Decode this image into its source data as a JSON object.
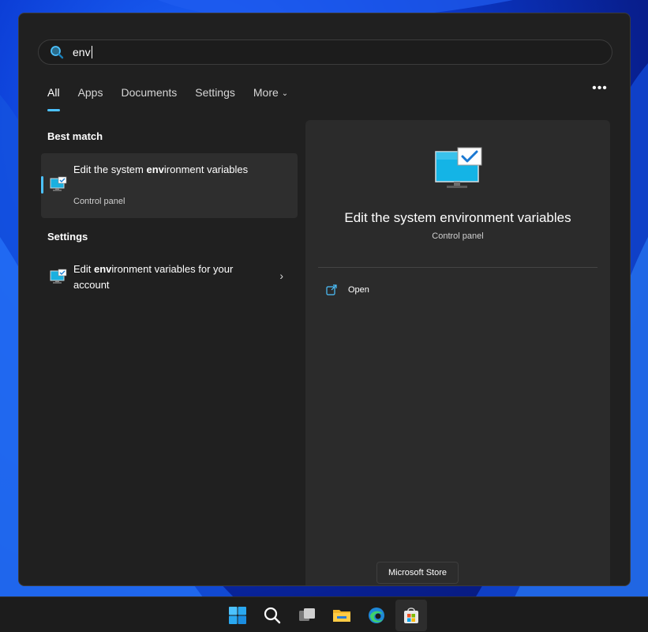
{
  "search": {
    "query": "env",
    "placeholder": ""
  },
  "tabs": [
    {
      "label": "All",
      "active": true
    },
    {
      "label": "Apps",
      "active": false
    },
    {
      "label": "Documents",
      "active": false
    },
    {
      "label": "Settings",
      "active": false
    },
    {
      "label": "More",
      "active": false
    }
  ],
  "more_menu": "•••",
  "best_match": {
    "heading": "Best match",
    "item": {
      "title_pre": "Edit the system ",
      "title_bold": "env",
      "title_post": "ironment variables",
      "subtitle": "Control panel",
      "icon": "system-properties-icon"
    }
  },
  "settings": {
    "heading": "Settings",
    "item": {
      "title_pre": "Edit ",
      "title_bold": "env",
      "title_post": "ironment variables for your account",
      "icon": "system-properties-icon"
    }
  },
  "preview": {
    "title": "Edit the system environment variables",
    "subtitle": "Control panel",
    "action_open": "Open",
    "icon": "monitor-check-icon"
  },
  "tooltip": "Microsoft Store",
  "taskbar": [
    {
      "name": "start-button",
      "icon": "windows-logo-icon"
    },
    {
      "name": "search-button",
      "icon": "search-icon"
    },
    {
      "name": "task-view-button",
      "icon": "task-view-icon"
    },
    {
      "name": "file-explorer-button",
      "icon": "folder-icon"
    },
    {
      "name": "edge-button",
      "icon": "edge-icon"
    },
    {
      "name": "microsoft-store-button",
      "icon": "store-icon"
    }
  ],
  "colors": {
    "accent": "#4cc2ff",
    "panel_bg": "#202020",
    "preview_bg": "#2b2b2b",
    "selected_bg": "#2e2e2e",
    "taskbar_bg": "#1c1c1c"
  }
}
